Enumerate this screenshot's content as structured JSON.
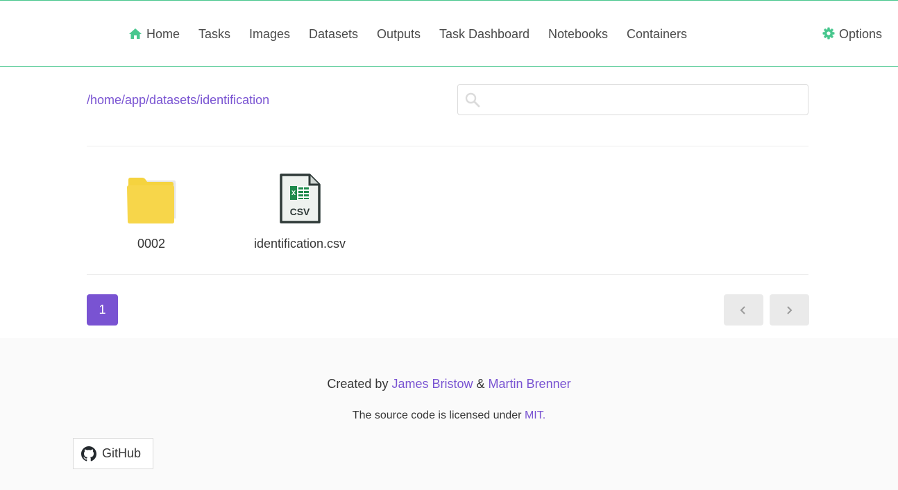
{
  "nav": {
    "items": [
      {
        "label": "Home",
        "icon": "home-icon"
      },
      {
        "label": "Tasks"
      },
      {
        "label": "Images"
      },
      {
        "label": "Datasets"
      },
      {
        "label": "Outputs"
      },
      {
        "label": "Task Dashboard"
      },
      {
        "label": "Notebooks"
      },
      {
        "label": "Containers"
      }
    ],
    "options": {
      "label": "Options",
      "icon": "gear-icon"
    },
    "accent_color": "#48c78e"
  },
  "breadcrumb": "/home/app/datasets/identification",
  "search": {
    "placeholder": "",
    "value": "",
    "icon": "search-icon"
  },
  "files": [
    {
      "name": "0002",
      "type": "folder",
      "icon": "folder-icon"
    },
    {
      "name": "identification.csv",
      "type": "csv",
      "icon": "csv-file-icon"
    }
  ],
  "pagination": {
    "current": "1",
    "prev_icon": "chevron-left-icon",
    "next_icon": "chevron-right-icon"
  },
  "footer": {
    "created_by": "Created by",
    "author1": "James Bristow",
    "and": "&",
    "author2": "Martin Brenner",
    "license_text": "The source code is licensed under",
    "license_link": "MIT",
    "license_suffix": ".",
    "github_label": "GitHub"
  },
  "colors": {
    "primary": "#7953d2",
    "accent": "#48c78e"
  }
}
